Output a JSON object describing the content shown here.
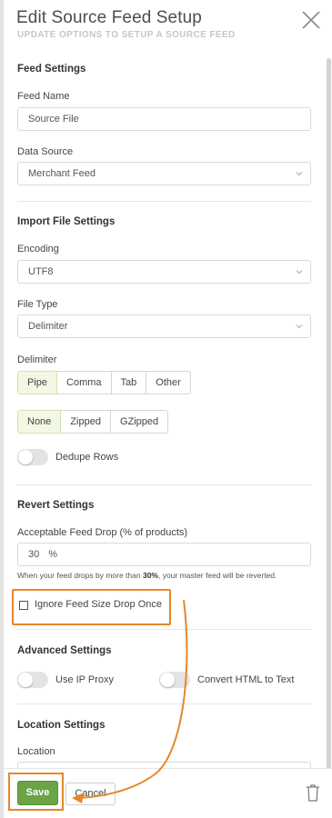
{
  "header": {
    "title": "Edit Source Feed Setup",
    "subtitle": "UPDATE OPTIONS TO SETUP A SOURCE FEED",
    "close_icon": "close-icon"
  },
  "feed_settings": {
    "title": "Feed Settings",
    "feed_name_label": "Feed Name",
    "feed_name_value": "Source File",
    "data_source_label": "Data Source",
    "data_source_value": "Merchant Feed"
  },
  "import_settings": {
    "title": "Import File Settings",
    "encoding_label": "Encoding",
    "encoding_value": "UTF8",
    "file_type_label": "File Type",
    "file_type_value": "Delimiter",
    "delimiter_label": "Delimiter",
    "delimiter_options": [
      "Pipe",
      "Comma",
      "Tab",
      "Other"
    ],
    "delimiter_selected": "Pipe",
    "compression_options": [
      "None",
      "Zipped",
      "GZipped"
    ],
    "compression_selected": "None",
    "dedupe_label": "Dedupe Rows",
    "dedupe_enabled": false
  },
  "revert_settings": {
    "title": "Revert Settings",
    "drop_label": "Acceptable Feed Drop (% of products)",
    "drop_value": "30",
    "drop_unit": "%",
    "helper_prefix": "When your feed drops by more than ",
    "helper_bold": "30%",
    "helper_suffix": ", your master feed will be reverted.",
    "ignore_label": "Ignore Feed Size Drop Once",
    "ignore_checked": false
  },
  "advanced_settings": {
    "title": "Advanced Settings",
    "ip_proxy_label": "Use IP Proxy",
    "ip_proxy_enabled": false,
    "convert_html_label": "Convert HTML to Text",
    "convert_html_enabled": false
  },
  "location_settings": {
    "title": "Location Settings",
    "location_label": "Location"
  },
  "footer": {
    "save_label": "Save",
    "cancel_label": "Cancel",
    "delete_icon": "trash-icon"
  },
  "colors": {
    "accent_green": "#6aa444",
    "highlight_orange": "#e6862a",
    "selected_segment": "#f2f8e4"
  }
}
